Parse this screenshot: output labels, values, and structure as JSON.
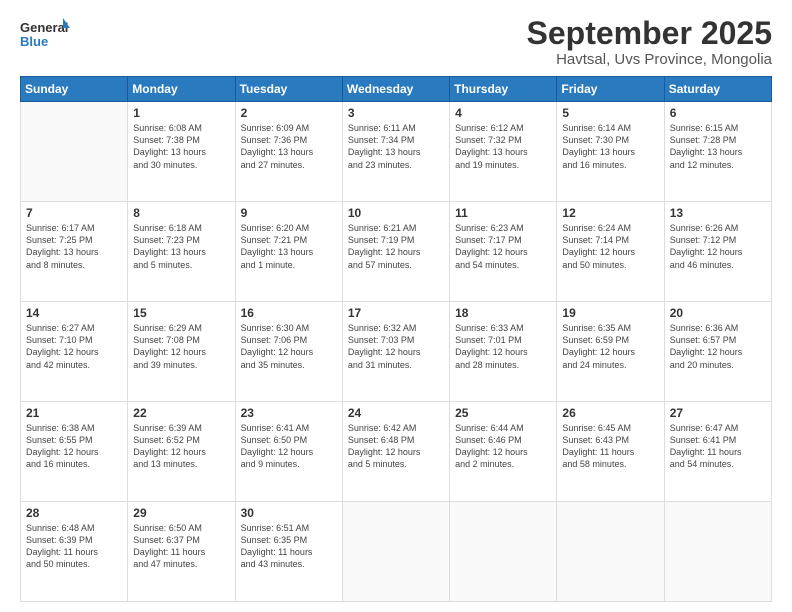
{
  "logo": {
    "general": "General",
    "blue": "Blue"
  },
  "title": "September 2025",
  "subtitle": "Havtsal, Uvs Province, Mongolia",
  "days_header": [
    "Sunday",
    "Monday",
    "Tuesday",
    "Wednesday",
    "Thursday",
    "Friday",
    "Saturday"
  ],
  "weeks": [
    [
      {
        "day": "",
        "info": ""
      },
      {
        "day": "1",
        "info": "Sunrise: 6:08 AM\nSunset: 7:38 PM\nDaylight: 13 hours\nand 30 minutes."
      },
      {
        "day": "2",
        "info": "Sunrise: 6:09 AM\nSunset: 7:36 PM\nDaylight: 13 hours\nand 27 minutes."
      },
      {
        "day": "3",
        "info": "Sunrise: 6:11 AM\nSunset: 7:34 PM\nDaylight: 13 hours\nand 23 minutes."
      },
      {
        "day": "4",
        "info": "Sunrise: 6:12 AM\nSunset: 7:32 PM\nDaylight: 13 hours\nand 19 minutes."
      },
      {
        "day": "5",
        "info": "Sunrise: 6:14 AM\nSunset: 7:30 PM\nDaylight: 13 hours\nand 16 minutes."
      },
      {
        "day": "6",
        "info": "Sunrise: 6:15 AM\nSunset: 7:28 PM\nDaylight: 13 hours\nand 12 minutes."
      }
    ],
    [
      {
        "day": "7",
        "info": "Sunrise: 6:17 AM\nSunset: 7:25 PM\nDaylight: 13 hours\nand 8 minutes."
      },
      {
        "day": "8",
        "info": "Sunrise: 6:18 AM\nSunset: 7:23 PM\nDaylight: 13 hours\nand 5 minutes."
      },
      {
        "day": "9",
        "info": "Sunrise: 6:20 AM\nSunset: 7:21 PM\nDaylight: 13 hours\nand 1 minute."
      },
      {
        "day": "10",
        "info": "Sunrise: 6:21 AM\nSunset: 7:19 PM\nDaylight: 12 hours\nand 57 minutes."
      },
      {
        "day": "11",
        "info": "Sunrise: 6:23 AM\nSunset: 7:17 PM\nDaylight: 12 hours\nand 54 minutes."
      },
      {
        "day": "12",
        "info": "Sunrise: 6:24 AM\nSunset: 7:14 PM\nDaylight: 12 hours\nand 50 minutes."
      },
      {
        "day": "13",
        "info": "Sunrise: 6:26 AM\nSunset: 7:12 PM\nDaylight: 12 hours\nand 46 minutes."
      }
    ],
    [
      {
        "day": "14",
        "info": "Sunrise: 6:27 AM\nSunset: 7:10 PM\nDaylight: 12 hours\nand 42 minutes."
      },
      {
        "day": "15",
        "info": "Sunrise: 6:29 AM\nSunset: 7:08 PM\nDaylight: 12 hours\nand 39 minutes."
      },
      {
        "day": "16",
        "info": "Sunrise: 6:30 AM\nSunset: 7:06 PM\nDaylight: 12 hours\nand 35 minutes."
      },
      {
        "day": "17",
        "info": "Sunrise: 6:32 AM\nSunset: 7:03 PM\nDaylight: 12 hours\nand 31 minutes."
      },
      {
        "day": "18",
        "info": "Sunrise: 6:33 AM\nSunset: 7:01 PM\nDaylight: 12 hours\nand 28 minutes."
      },
      {
        "day": "19",
        "info": "Sunrise: 6:35 AM\nSunset: 6:59 PM\nDaylight: 12 hours\nand 24 minutes."
      },
      {
        "day": "20",
        "info": "Sunrise: 6:36 AM\nSunset: 6:57 PM\nDaylight: 12 hours\nand 20 minutes."
      }
    ],
    [
      {
        "day": "21",
        "info": "Sunrise: 6:38 AM\nSunset: 6:55 PM\nDaylight: 12 hours\nand 16 minutes."
      },
      {
        "day": "22",
        "info": "Sunrise: 6:39 AM\nSunset: 6:52 PM\nDaylight: 12 hours\nand 13 minutes."
      },
      {
        "day": "23",
        "info": "Sunrise: 6:41 AM\nSunset: 6:50 PM\nDaylight: 12 hours\nand 9 minutes."
      },
      {
        "day": "24",
        "info": "Sunrise: 6:42 AM\nSunset: 6:48 PM\nDaylight: 12 hours\nand 5 minutes."
      },
      {
        "day": "25",
        "info": "Sunrise: 6:44 AM\nSunset: 6:46 PM\nDaylight: 12 hours\nand 2 minutes."
      },
      {
        "day": "26",
        "info": "Sunrise: 6:45 AM\nSunset: 6:43 PM\nDaylight: 11 hours\nand 58 minutes."
      },
      {
        "day": "27",
        "info": "Sunrise: 6:47 AM\nSunset: 6:41 PM\nDaylight: 11 hours\nand 54 minutes."
      }
    ],
    [
      {
        "day": "28",
        "info": "Sunrise: 6:48 AM\nSunset: 6:39 PM\nDaylight: 11 hours\nand 50 minutes."
      },
      {
        "day": "29",
        "info": "Sunrise: 6:50 AM\nSunset: 6:37 PM\nDaylight: 11 hours\nand 47 minutes."
      },
      {
        "day": "30",
        "info": "Sunrise: 6:51 AM\nSunset: 6:35 PM\nDaylight: 11 hours\nand 43 minutes."
      },
      {
        "day": "",
        "info": ""
      },
      {
        "day": "",
        "info": ""
      },
      {
        "day": "",
        "info": ""
      },
      {
        "day": "",
        "info": ""
      }
    ]
  ]
}
